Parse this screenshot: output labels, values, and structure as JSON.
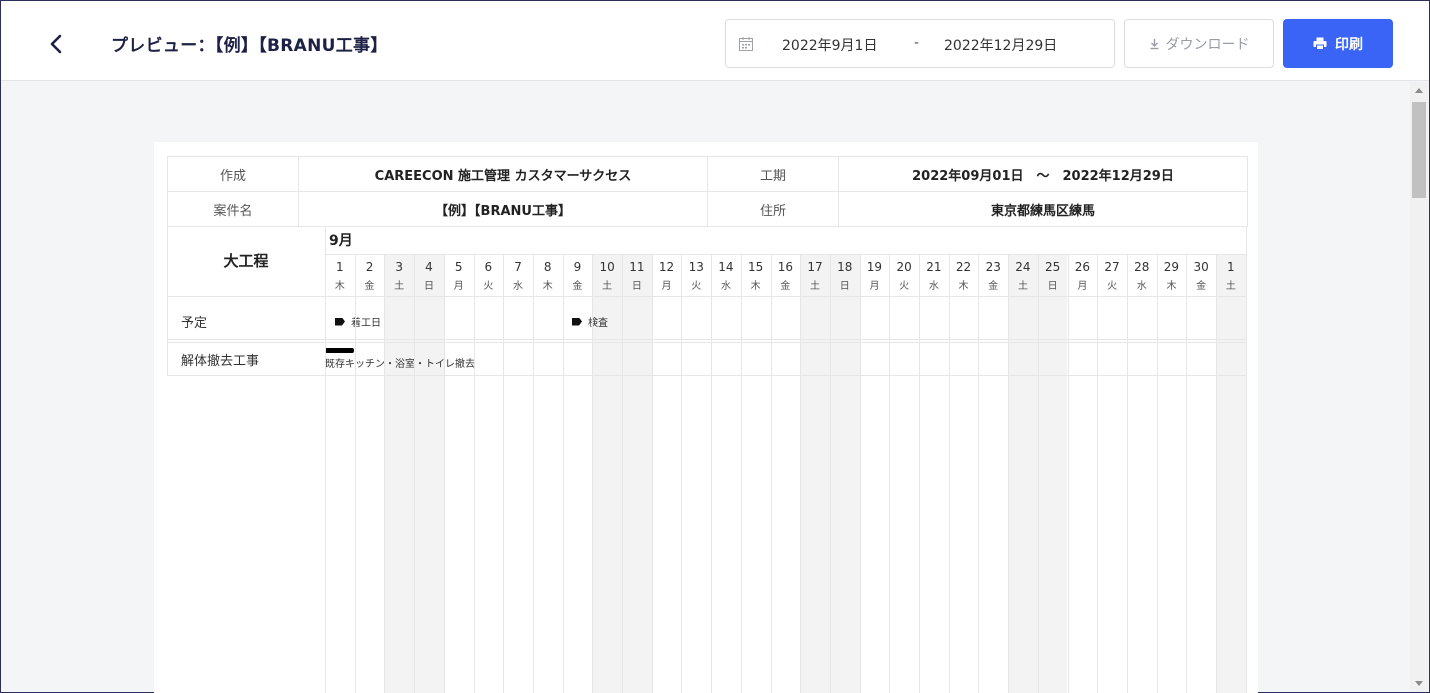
{
  "header": {
    "title": "プレビュー：【例】【BRANU工事】",
    "date_from": "2022年9月1日",
    "date_sep": "-",
    "date_to": "2022年12月29日",
    "download_label": "ダウンロード",
    "print_label": "印刷"
  },
  "info": {
    "creator_label": "作成",
    "creator_value": "CAREECON 施工管理 カスタマーサクセス",
    "period_label": "工期",
    "period_value": "2022年09月01日　～　2022年12月29日",
    "case_label": "案件名",
    "case_value": "【例】【BRANU工事】",
    "address_label": "住所",
    "address_value": "東京都練馬区練馬"
  },
  "gantt": {
    "big_process_label": "大工程",
    "month_label": "9月",
    "days": [
      {
        "d": "1",
        "w": "木",
        "h": false
      },
      {
        "d": "2",
        "w": "金",
        "h": false
      },
      {
        "d": "3",
        "w": "土",
        "h": true
      },
      {
        "d": "4",
        "w": "日",
        "h": true
      },
      {
        "d": "5",
        "w": "月",
        "h": false
      },
      {
        "d": "6",
        "w": "火",
        "h": false
      },
      {
        "d": "7",
        "w": "水",
        "h": false
      },
      {
        "d": "8",
        "w": "木",
        "h": false
      },
      {
        "d": "9",
        "w": "金",
        "h": false
      },
      {
        "d": "10",
        "w": "土",
        "h": true
      },
      {
        "d": "11",
        "w": "日",
        "h": true
      },
      {
        "d": "12",
        "w": "月",
        "h": false
      },
      {
        "d": "13",
        "w": "火",
        "h": false
      },
      {
        "d": "14",
        "w": "水",
        "h": false
      },
      {
        "d": "15",
        "w": "木",
        "h": false
      },
      {
        "d": "16",
        "w": "金",
        "h": false
      },
      {
        "d": "17",
        "w": "土",
        "h": true
      },
      {
        "d": "18",
        "w": "日",
        "h": true
      },
      {
        "d": "19",
        "w": "月",
        "h": false
      },
      {
        "d": "20",
        "w": "火",
        "h": false
      },
      {
        "d": "21",
        "w": "水",
        "h": false
      },
      {
        "d": "22",
        "w": "木",
        "h": false
      },
      {
        "d": "23",
        "w": "金",
        "h": false
      },
      {
        "d": "24",
        "w": "土",
        "h": true
      },
      {
        "d": "25",
        "w": "日",
        "h": true
      },
      {
        "d": "26",
        "w": "月",
        "h": false
      },
      {
        "d": "27",
        "w": "火",
        "h": false
      },
      {
        "d": "28",
        "w": "水",
        "h": false
      },
      {
        "d": "29",
        "w": "木",
        "h": false
      },
      {
        "d": "30",
        "w": "金",
        "h": false
      },
      {
        "d": "1",
        "w": "土",
        "h": true
      }
    ],
    "rows": {
      "schedule_label": "予定",
      "milestone_1": "着工日",
      "milestone_2": "検査",
      "task_row_label": "解体撤去工事",
      "task_label": "既存キッチン・浴室・トイレ撤去"
    }
  }
}
